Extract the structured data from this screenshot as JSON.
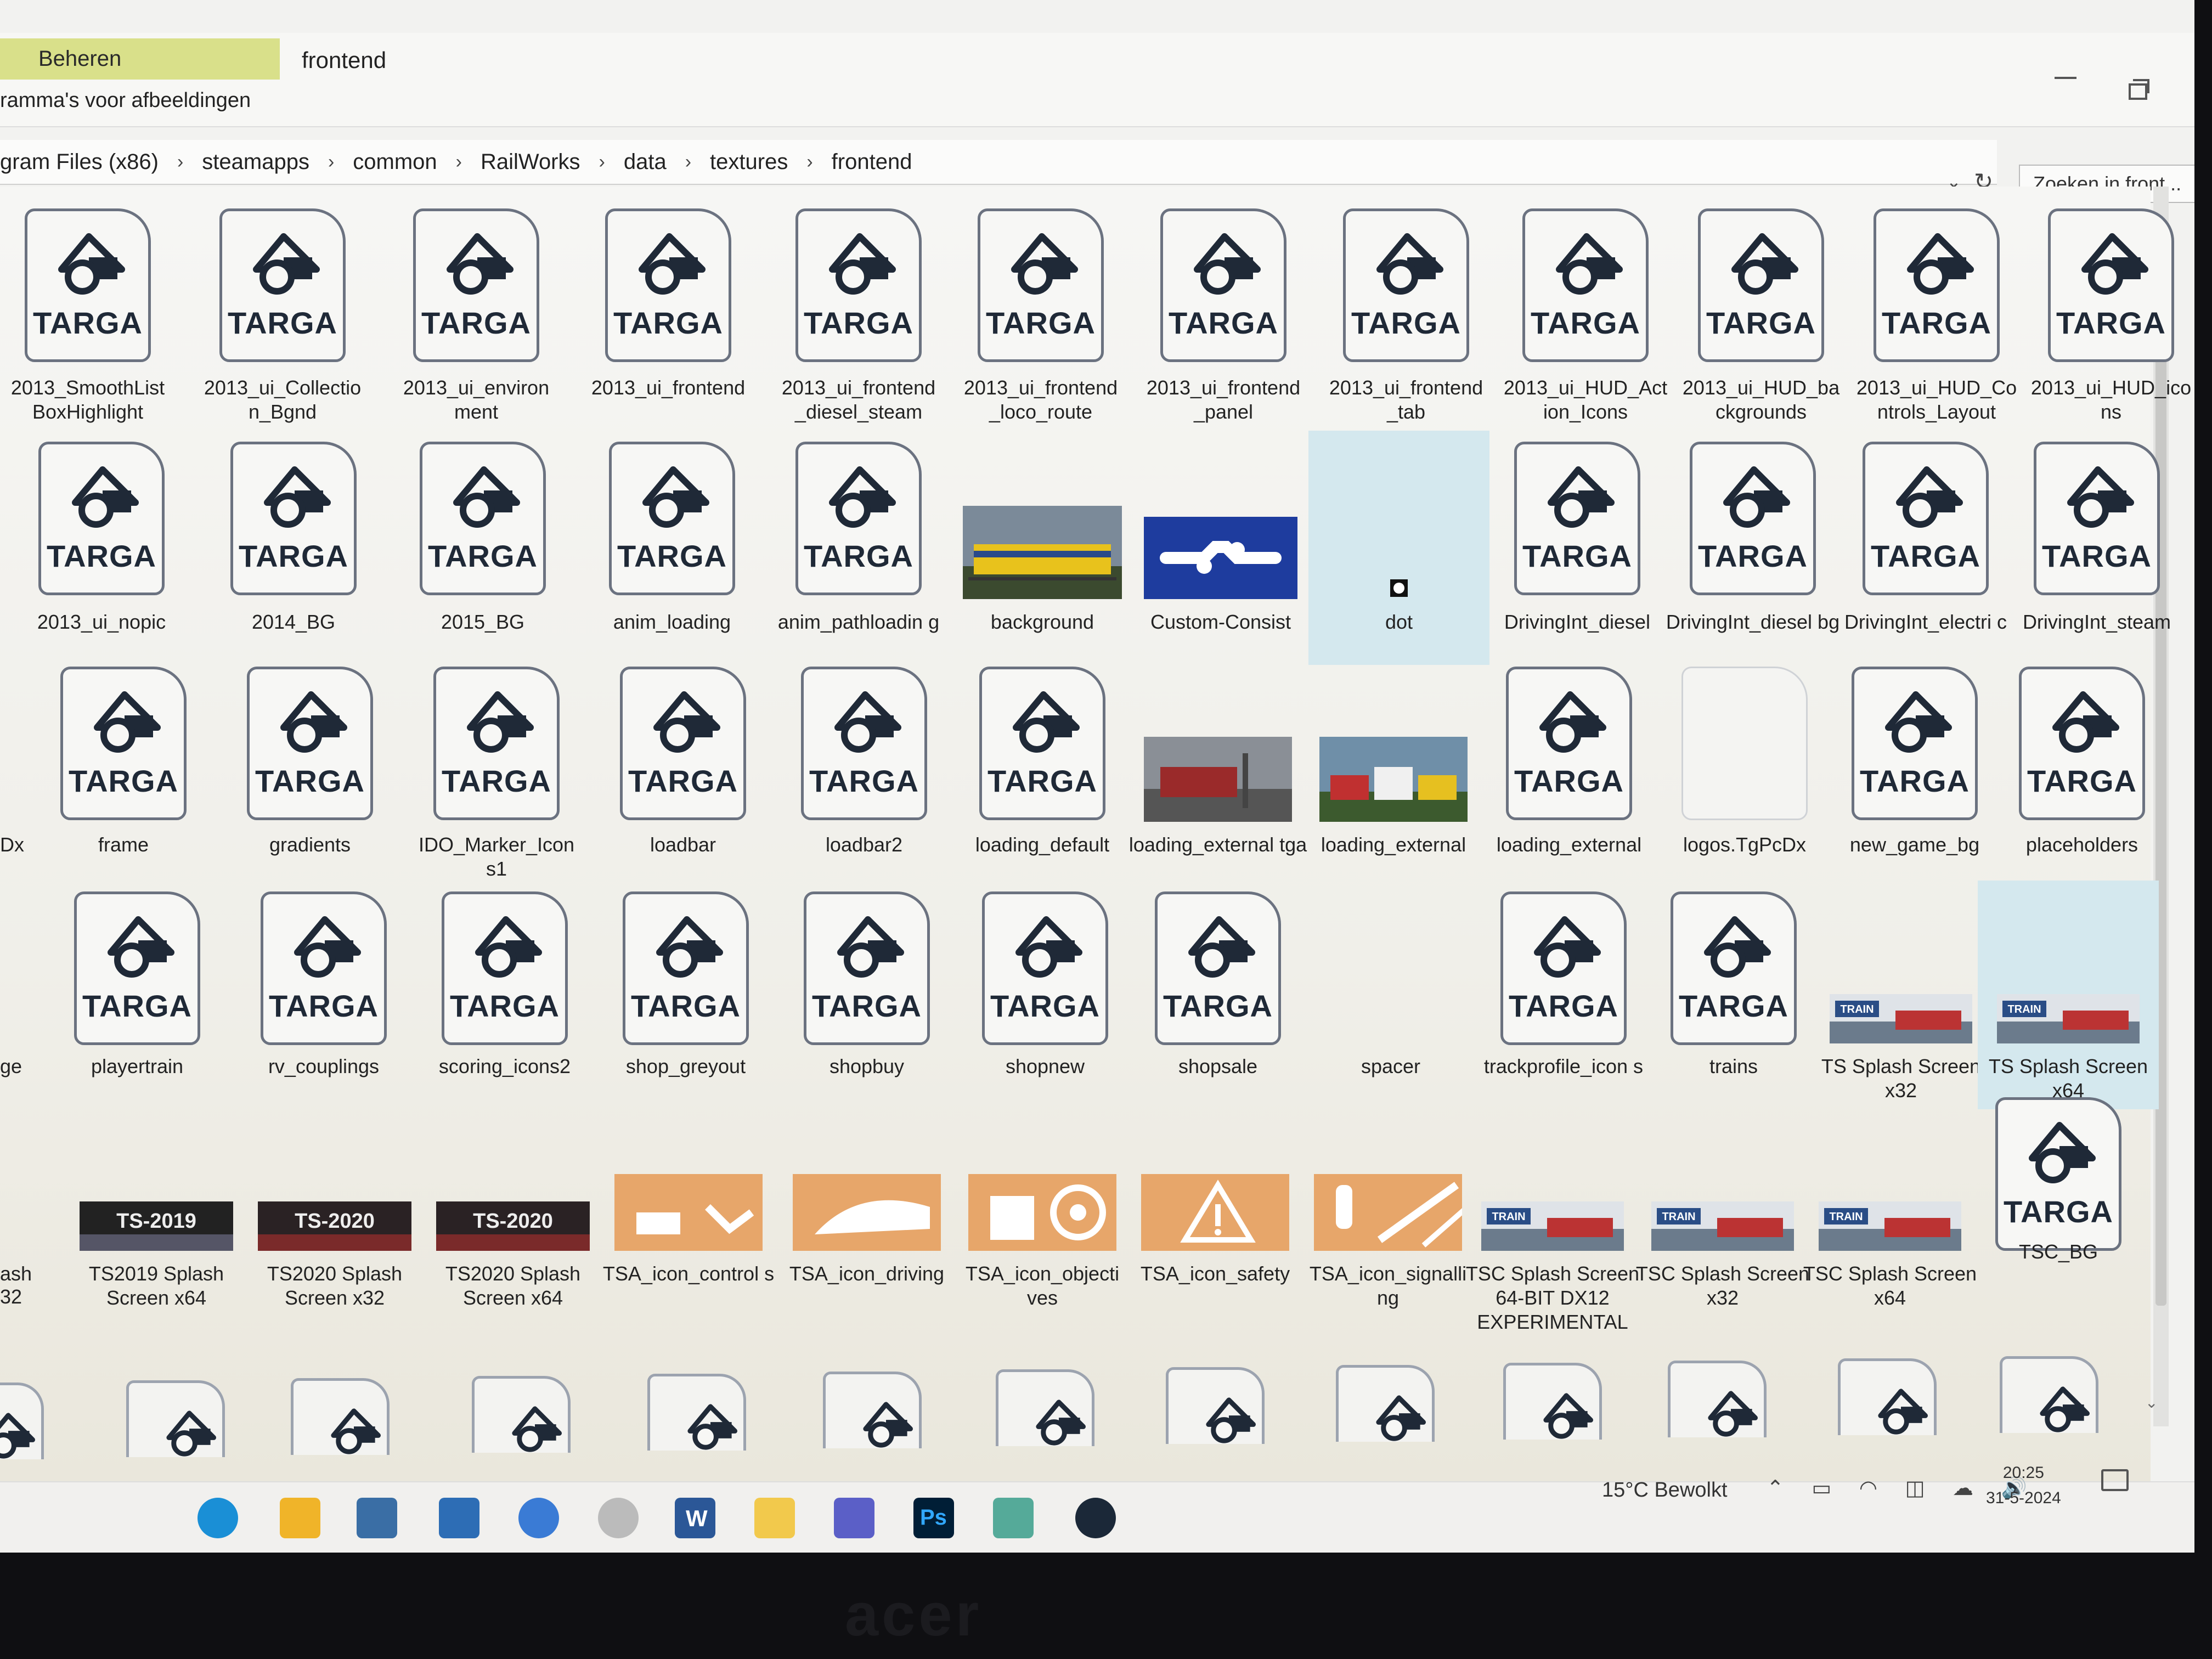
{
  "ribbon": {
    "manage_tab": "Beheren",
    "window_title": "frontend",
    "context_label": "ramma's voor afbeeldingen"
  },
  "address": {
    "crumbs": [
      "gram Files (x86)",
      "steamapps",
      "common",
      "RailWorks",
      "data",
      "textures",
      "frontend"
    ],
    "search_placeholder": "Zoeken in front..."
  },
  "files": [
    {
      "name": "2013_SmoothList BoxHighlight",
      "kind": "targa"
    },
    {
      "name": "2013_ui_Collectio n_Bgnd",
      "kind": "targa"
    },
    {
      "name": "2013_ui_environ ment",
      "kind": "targa"
    },
    {
      "name": "2013_ui_frontend",
      "kind": "targa"
    },
    {
      "name": "2013_ui_frontend _diesel_steam",
      "kind": "targa"
    },
    {
      "name": "2013_ui_frontend _loco_route",
      "kind": "targa"
    },
    {
      "name": "2013_ui_frontend _panel",
      "kind": "targa"
    },
    {
      "name": "2013_ui_frontend _tab",
      "kind": "targa"
    },
    {
      "name": "2013_ui_HUD_Act ion_Icons",
      "kind": "targa"
    },
    {
      "name": "2013_ui_HUD_ba ckgrounds",
      "kind": "targa"
    },
    {
      "name": "2013_ui_HUD_Co ntrols_Layout",
      "kind": "targa"
    },
    {
      "name": "2013_ui_HUD_ico ns",
      "kind": "targa"
    },
    {
      "name": "2013_ui_nopic",
      "kind": "targa"
    },
    {
      "name": "2014_BG",
      "kind": "targa"
    },
    {
      "name": "2015_BG",
      "kind": "targa"
    },
    {
      "name": "anim_loading",
      "kind": "targa"
    },
    {
      "name": "anim_pathloadin g",
      "kind": "targa"
    },
    {
      "name": "background",
      "kind": "image-train"
    },
    {
      "name": "Custom-Consist",
      "kind": "image-consist"
    },
    {
      "name": "dot",
      "kind": "image-dot"
    },
    {
      "name": "DrivingInt_diesel",
      "kind": "targa"
    },
    {
      "name": "DrivingInt_diesel bg",
      "kind": "targa"
    },
    {
      "name": "DrivingInt_electri c",
      "kind": "targa"
    },
    {
      "name": "DrivingInt_steam",
      "kind": "targa"
    },
    {
      "name": "frame",
      "kind": "targa"
    },
    {
      "name": "gradients",
      "kind": "targa"
    },
    {
      "name": "IDO_Marker_Icon s1",
      "kind": "targa"
    },
    {
      "name": "loadbar",
      "kind": "targa"
    },
    {
      "name": "loadbar2",
      "kind": "targa"
    },
    {
      "name": "loading_default",
      "kind": "targa"
    },
    {
      "name": "loading_external tga",
      "kind": "image-station"
    },
    {
      "name": "loading_external",
      "kind": "image-trains"
    },
    {
      "name": "loading_external",
      "kind": "targa"
    },
    {
      "name": "logos.TgPcDx",
      "kind": "blank"
    },
    {
      "name": "new_game_bg",
      "kind": "targa"
    },
    {
      "name": "placeholders",
      "kind": "targa"
    },
    {
      "name": "playertrain",
      "kind": "targa"
    },
    {
      "name": "rv_couplings",
      "kind": "targa"
    },
    {
      "name": "scoring_icons2",
      "kind": "targa"
    },
    {
      "name": "shop_greyout",
      "kind": "targa"
    },
    {
      "name": "shopbuy",
      "kind": "targa"
    },
    {
      "name": "shopnew",
      "kind": "targa"
    },
    {
      "name": "shopsale",
      "kind": "targa"
    },
    {
      "name": "spacer",
      "kind": "empty"
    },
    {
      "name": "trackprofile_icon s",
      "kind": "targa"
    },
    {
      "name": "trains",
      "kind": "targa"
    },
    {
      "name": "TS Splash Screen x32",
      "kind": "image-splash"
    },
    {
      "name": "TS Splash Screen x64",
      "kind": "image-splash"
    },
    {
      "name": "TSC_BG",
      "kind": "targa"
    },
    {
      "name": "TS2019 Splash Screen x64",
      "kind": "image-ts2019"
    },
    {
      "name": "TS2020 Splash Screen x32",
      "kind": "image-ts2020"
    },
    {
      "name": "TS2020 Splash Screen x64",
      "kind": "image-ts2020"
    },
    {
      "name": "TSA_icon_control s",
      "kind": "image-tsa-controls"
    },
    {
      "name": "TSA_icon_driving",
      "kind": "image-tsa-driving"
    },
    {
      "name": "TSA_icon_objecti ves",
      "kind": "image-tsa-objectives"
    },
    {
      "name": "TSA_icon_safety",
      "kind": "image-tsa-safety"
    },
    {
      "name": "TSA_icon_signalli ng",
      "kind": "image-tsa-signalling"
    },
    {
      "name": "TSC Splash Screen 64-BIT DX12 EXPERIMENTAL",
      "kind": "image-splash"
    },
    {
      "name": "TSC Splash Screen x32",
      "kind": "image-splash"
    },
    {
      "name": "TSC Splash Screen x64",
      "kind": "image-splash"
    }
  ],
  "partial_left": {
    "row3_label": "Dx",
    "row4_label": "ge",
    "row5_line1": "ash",
    "row5_line2": "32"
  },
  "icon_label": "TARGA",
  "splash_badge": "TRAIN",
  "ts2019_badge": "TS-2019",
  "ts2020_badge": "TS-2020",
  "taskbar": {
    "icons": [
      "edge-icon",
      "file-explorer-icon",
      "store-icon",
      "mail-icon",
      "browser-icon",
      "itunes-icon",
      "word-icon",
      "notes-icon",
      "teams-icon",
      "photoshop-icon",
      "app-icon",
      "steam-icon"
    ],
    "weather": "15°C  Bewolkt",
    "time": "20:25",
    "date": "31-5-2024"
  },
  "bezel_brand": "acer",
  "colors": {
    "manage_tab": "#d9e08a",
    "selection": "#d4e8ee",
    "tsa_orange": "#e7a66a"
  }
}
